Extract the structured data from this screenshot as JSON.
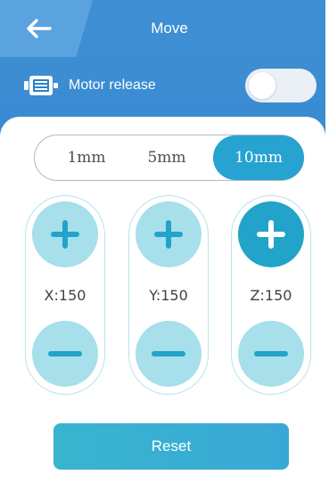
{
  "header": {
    "title": "Move",
    "back_icon": "arrow-left-icon"
  },
  "motor": {
    "label": "Motor release",
    "icon": "motor-icon",
    "toggle_on": false
  },
  "step": {
    "options": [
      "1mm",
      "5mm",
      "10mm"
    ],
    "selected": "10mm"
  },
  "axes": [
    {
      "label": "X:150",
      "plus_icon": "plus-icon",
      "minus_icon": "minus-icon"
    },
    {
      "label": "Y:150",
      "plus_icon": "plus-icon",
      "minus_icon": "minus-icon"
    },
    {
      "label": "Z:150",
      "plus_icon": "plus-icon",
      "minus_icon": "minus-icon"
    }
  ],
  "reset_label": "Reset",
  "colors": {
    "header_blue": "#2a82c9",
    "accent": "#26a3d0",
    "button_light": "#a7dfeb"
  }
}
